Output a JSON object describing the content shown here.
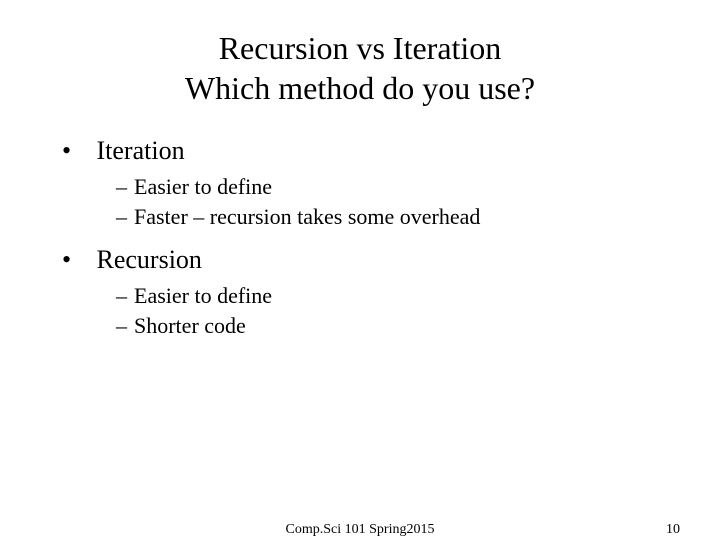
{
  "title_line1": "Recursion vs Iteration",
  "title_line2": "Which method do you use?",
  "items": [
    {
      "label": "Iteration",
      "sub": [
        "Easier to define",
        "Faster – recursion takes some overhead"
      ]
    },
    {
      "label": "Recursion",
      "sub": [
        "Easier to define",
        "Shorter code"
      ]
    }
  ],
  "footer": {
    "course": "Comp.Sci 101  Spring2015",
    "page": "10"
  }
}
